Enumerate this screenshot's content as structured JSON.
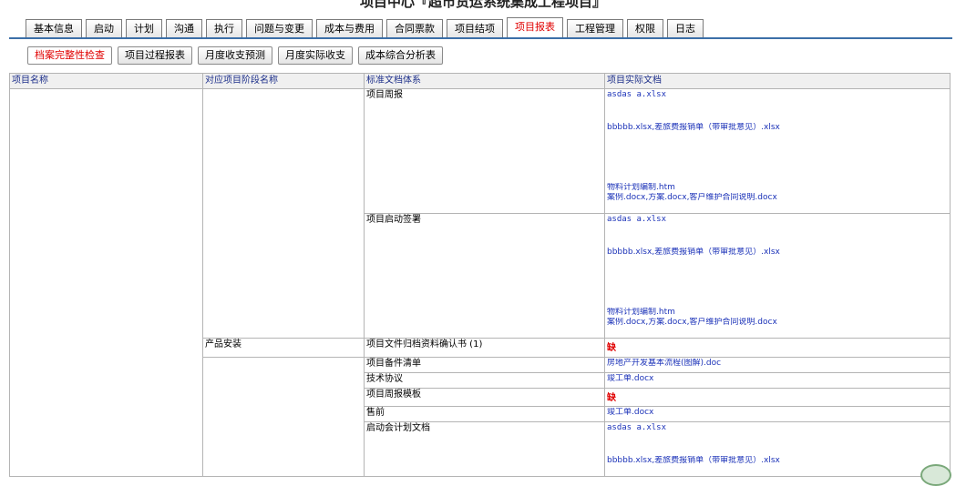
{
  "page": {
    "title": "项目中心『超市货运系统集成工程项目』"
  },
  "main_tabs": [
    {
      "label": "基本信息"
    },
    {
      "label": "启动"
    },
    {
      "label": "计划"
    },
    {
      "label": "沟通"
    },
    {
      "label": "执行"
    },
    {
      "label": "问题与变更"
    },
    {
      "label": "成本与费用"
    },
    {
      "label": "合同票款"
    },
    {
      "label": "项目结项"
    },
    {
      "label": "项目报表",
      "active": true
    },
    {
      "label": "工程管理"
    },
    {
      "label": "权限"
    },
    {
      "label": "日志"
    }
  ],
  "sub_tabs": [
    {
      "label": "档案完整性检查",
      "active": true
    },
    {
      "label": "项目过程报表"
    },
    {
      "label": "月度收支预测"
    },
    {
      "label": "月度实际收支"
    },
    {
      "label": "成本综合分析表"
    }
  ],
  "table": {
    "headers": [
      "项目名称",
      "对应项目阶段名称",
      "标准文档体系",
      "项目实际文档"
    ],
    "stage_install": "产品安装",
    "rows": [
      {
        "name": "项目周报",
        "docs": [
          "asdas a.xlsx",
          "bbbbb.xlsx,差旅费报销单（带审批意见）.xlsx",
          "物料计划编制.htm",
          "案例.docx,方案.docx,客户维护合同说明.docx"
        ]
      },
      {
        "name": "项目启动签署",
        "docs": [
          "asdas a.xlsx",
          "bbbbb.xlsx,差旅费报销单（带审批意见）.xlsx",
          "物料计划编制.htm",
          "案例.docx,方案.docx,客户维护合同说明.docx"
        ]
      },
      {
        "name": "项目文件归档资料确认书 (1)",
        "missing": "缺"
      },
      {
        "name": "项目备件清单",
        "docs": [
          "房地产开发基本流程(图解).doc"
        ]
      },
      {
        "name": "技术协议",
        "docs": [
          "竣工单.docx"
        ]
      },
      {
        "name": "项目周报模板",
        "missing": "缺"
      },
      {
        "name": "售前",
        "docs": [
          "竣工单.docx"
        ]
      },
      {
        "name": "启动会计划文档",
        "docs": [
          "asdas a.xlsx",
          "bbbbb.xlsx,差旅费报销单（带审批意见）.xlsx"
        ]
      }
    ]
  }
}
